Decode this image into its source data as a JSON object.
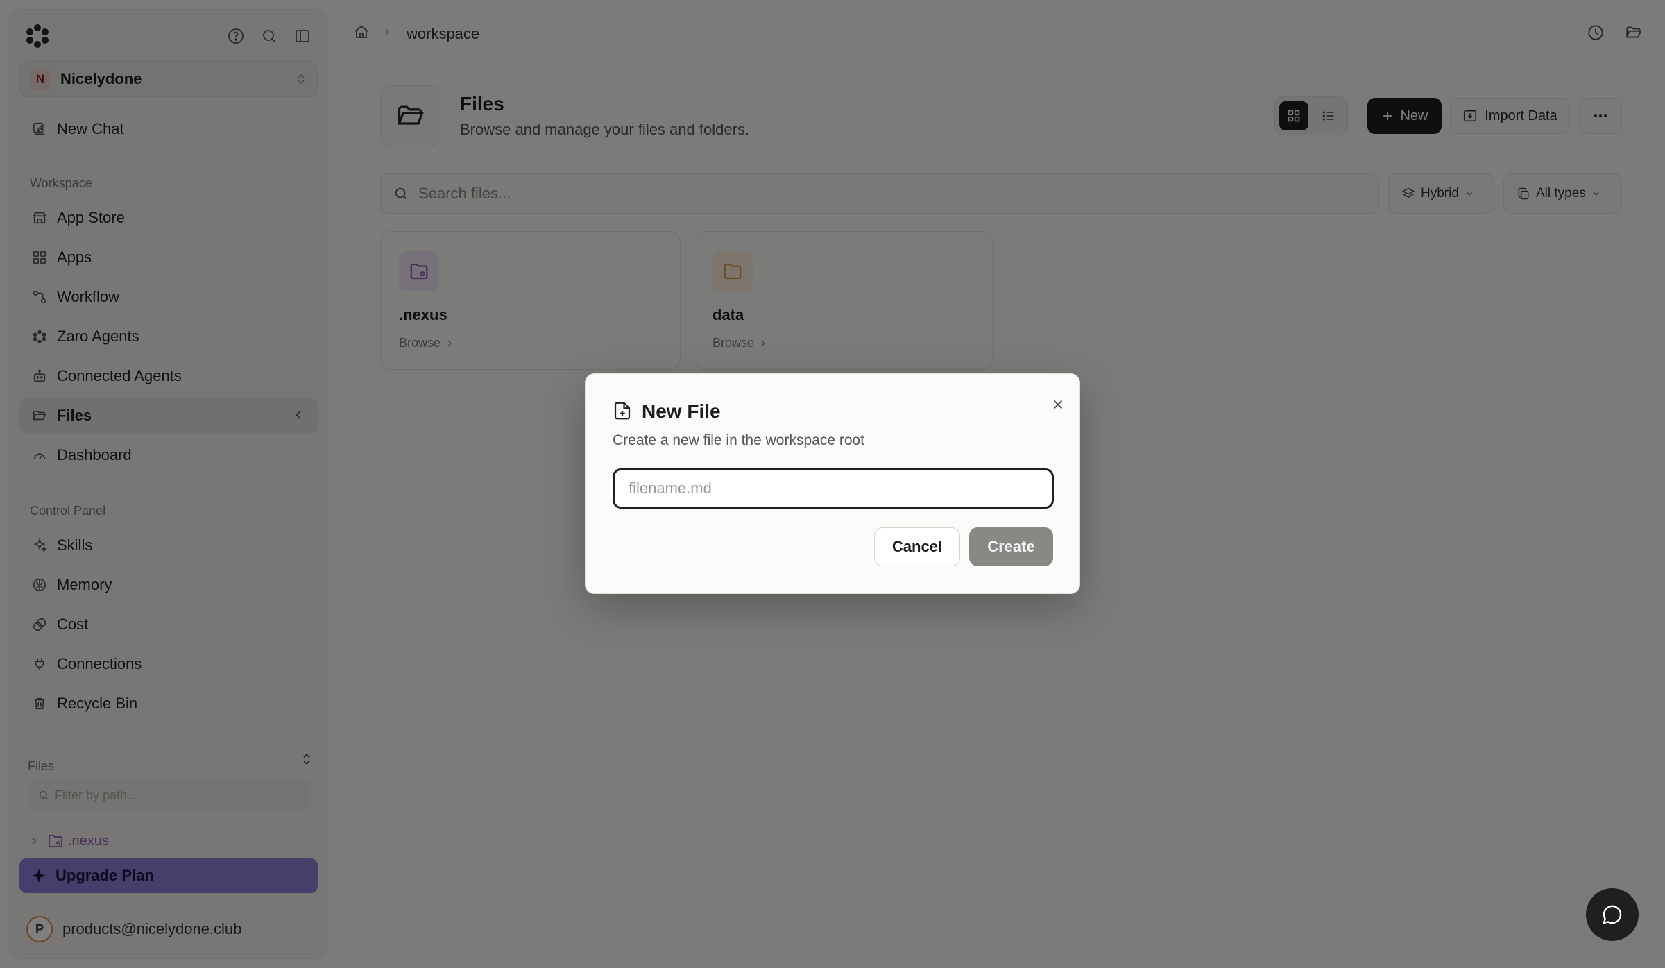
{
  "sidebar": {
    "workspace": {
      "initial": "N",
      "name": "Nicelydone"
    },
    "new_chat": "New Chat",
    "section_workspace": "Workspace",
    "items_workspace": [
      {
        "label": "App Store",
        "icon": "store-icon"
      },
      {
        "label": "Apps",
        "icon": "apps-grid-icon"
      },
      {
        "label": "Workflow",
        "icon": "workflow-icon"
      },
      {
        "label": "Zaro Agents",
        "icon": "agents-icon"
      },
      {
        "label": "Connected Agents",
        "icon": "bot-icon"
      },
      {
        "label": "Files",
        "icon": "folder-open-icon",
        "active": true
      },
      {
        "label": "Dashboard",
        "icon": "gauge-icon"
      }
    ],
    "section_control": "Control Panel",
    "items_control": [
      {
        "label": "Skills",
        "icon": "sparkles-icon"
      },
      {
        "label": "Memory",
        "icon": "brain-icon"
      },
      {
        "label": "Cost",
        "icon": "coins-icon"
      },
      {
        "label": "Connections",
        "icon": "plug-icon"
      },
      {
        "label": "Recycle Bin",
        "icon": "trash-icon"
      }
    ],
    "files_section": "Files",
    "filter_placeholder": "Filter by path...",
    "tree": [
      {
        "label": ".nexus"
      }
    ],
    "upgrade": "Upgrade Plan",
    "user": {
      "initial": "P",
      "email": "products@nicelydone.club"
    }
  },
  "breadcrumb": {
    "current": "workspace"
  },
  "header": {
    "title": "Files",
    "subtitle": "Browse and manage your files and folders."
  },
  "toolbar": {
    "new_label": "New",
    "import_label": "Import Data"
  },
  "search": {
    "placeholder": "Search files..."
  },
  "filters": {
    "mode": "Hybrid",
    "types": "All types"
  },
  "cards": [
    {
      "name": ".nexus",
      "browse": "Browse",
      "color": "#8a5bb0"
    },
    {
      "name": "data",
      "browse": "Browse",
      "color": "#d69a3c"
    }
  ],
  "modal": {
    "title": "New File",
    "description": "Create a new file in the workspace root",
    "input_placeholder": "filename.md",
    "cancel": "Cancel",
    "create": "Create"
  },
  "colors": {
    "accent_dark": "#1f1f1f",
    "upgrade_bg": "#8d7fd6",
    "nexus_folder": "#8a5bb0",
    "data_folder": "#d69a3c"
  }
}
